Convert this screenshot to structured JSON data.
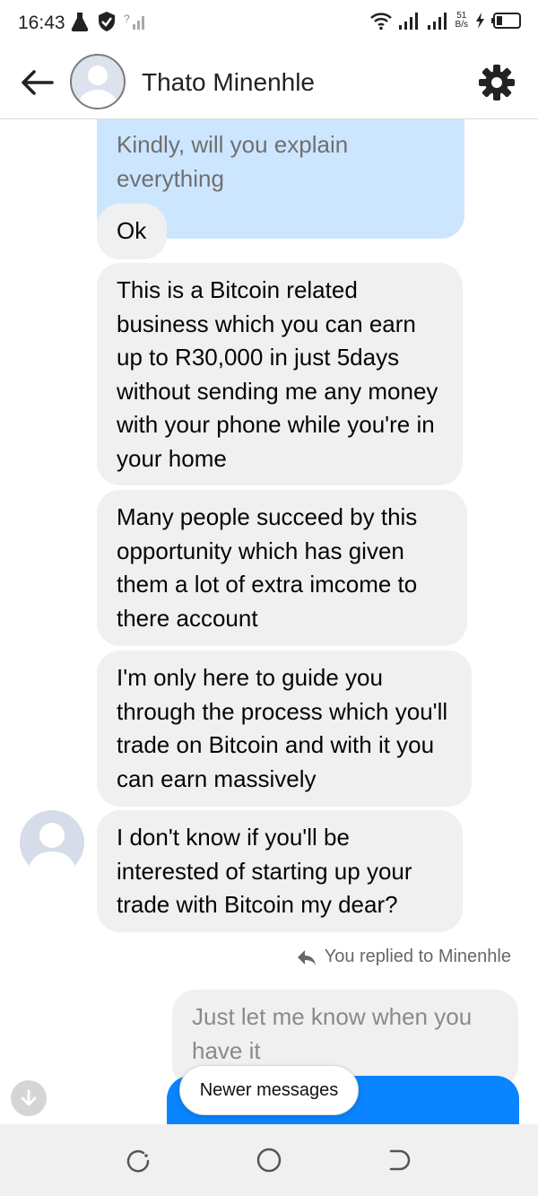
{
  "status_bar": {
    "time": "16:43",
    "net_speed_top": "51",
    "net_speed_bottom": "B/s",
    "icons": [
      "flask-icon",
      "shield-icon",
      "sim-signal-icon",
      "wifi-icon",
      "signal-icon",
      "signal-icon",
      "charging-icon",
      "battery-icon"
    ]
  },
  "header": {
    "contact_name": "Thato Minenhle",
    "icons": [
      "back-arrow-icon",
      "profile-avatar",
      "gear-icon"
    ]
  },
  "messages": [
    {
      "direction": "outgoing",
      "status": "pending",
      "text": "Kindly, will you explain everything"
    },
    {
      "direction": "incoming",
      "text": "Ok"
    },
    {
      "direction": "incoming",
      "text": "This is a Bitcoin related business which you can earn up to R30,000 in just 5days without sending me any money with your phone while you're in your home"
    },
    {
      "direction": "incoming",
      "text": "Many people succeed by this opportunity which has given them a lot of extra imcome to there account"
    },
    {
      "direction": "incoming",
      "text": "I'm only here to guide you through the process which you'll trade on Bitcoin and with it you can earn massively"
    },
    {
      "direction": "incoming",
      "text": "I don't know if you'll be interested of starting up your trade with Bitcoin my dear?"
    }
  ],
  "reply_context": {
    "label": "You replied to Minenhle",
    "quoted_text": "Just let me know when you have it",
    "icon": "reply-arrow-icon"
  },
  "newer_messages_label": "Newer messages",
  "colors": {
    "accent": "#0a84ff",
    "pending_bubble": "#cde6ff",
    "incoming_bubble": "#f0f0f0"
  },
  "nav_bar": {
    "icons": [
      "recent-apps-icon",
      "home-icon",
      "back-icon"
    ]
  }
}
